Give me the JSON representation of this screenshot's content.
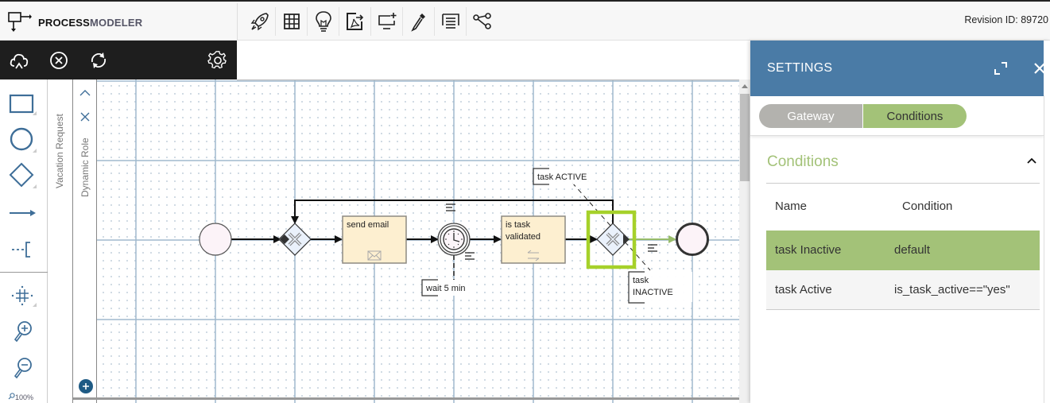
{
  "app": {
    "name_bold": "PROCESS",
    "name_light": "MODELER",
    "revision": "Revision ID: 89720"
  },
  "toolbar": {
    "tools": [
      "rocket-icon",
      "grid-icon",
      "lightbulb-icon",
      "export-pdf-icon",
      "add-screen-icon",
      "eyedropper-icon",
      "text-list-icon",
      "share-nodes-icon"
    ]
  },
  "actionbar": {
    "icons": [
      "cloud-upload-icon",
      "cancel-circle-icon",
      "refresh-icon",
      "gear-icon"
    ]
  },
  "palette": {
    "items": [
      "task-shape",
      "event-shape",
      "gateway-shape",
      "sequence-flow",
      "annotation"
    ],
    "nav": [
      "move-canvas",
      "zoom-in",
      "zoom-out"
    ],
    "zoom_level": "100%"
  },
  "lanes": {
    "pool": "Vacation Request",
    "lane": "Dynamic Role"
  },
  "diagram": {
    "tasks": [
      {
        "line1": "send email",
        "line2": ""
      },
      {
        "line1": "is task",
        "line2": "validated"
      }
    ],
    "timer_annotation": "wait 5 min",
    "annotation_active": "task ACTIVE",
    "annotation_inactive_1": "task",
    "annotation_inactive_2": "INACTIVE",
    "selection_color": "#a6d12a",
    "default_flow_color": "#98bc6a"
  },
  "settings": {
    "title": "SETTINGS",
    "tabs": [
      {
        "label": "Gateway",
        "active": false
      },
      {
        "label": "Conditions",
        "active": true
      }
    ],
    "section_title": "Conditions",
    "table": {
      "headers": [
        "Name",
        "Condition"
      ],
      "rows": [
        {
          "name": "task Inactive",
          "condition": "default",
          "selected": true
        },
        {
          "name": "task Active",
          "condition": "is_task_active==\"yes\"",
          "selected": false
        }
      ]
    }
  }
}
